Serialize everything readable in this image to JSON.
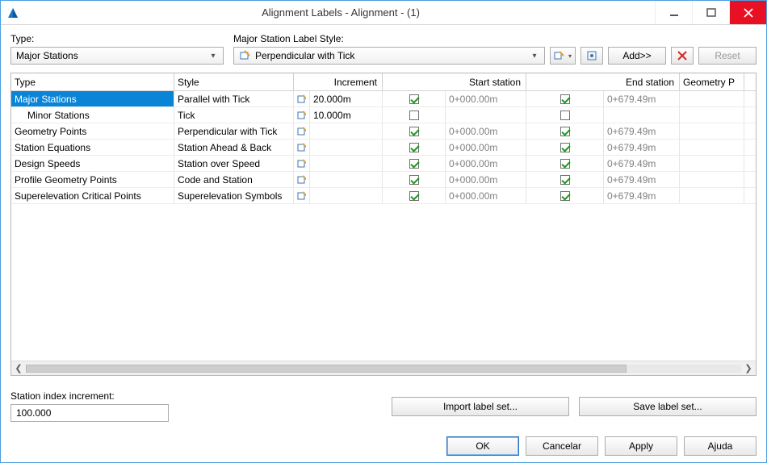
{
  "titlebar": {
    "title": "Alignment Labels - Alignment - (1)"
  },
  "top": {
    "type_label": "Type:",
    "type_value": "Major Stations",
    "style_label": "Major Station Label Style:",
    "style_value": "Perpendicular with Tick",
    "add_label": "Add>>",
    "reset_label": "Reset"
  },
  "columns": {
    "type": "Type",
    "style": "Style",
    "increment": "Increment",
    "start": "Start station",
    "end": "End station",
    "geo": "Geometry P"
  },
  "rows": [
    {
      "type": "Major Stations",
      "indent": 0,
      "sel": true,
      "style": "Parallel with Tick",
      "inc": "20.000m",
      "ss_ck": true,
      "ss": "0+000.00m",
      "es_ck": true,
      "es": "0+679.49m"
    },
    {
      "type": "Minor Stations",
      "indent": 1,
      "sel": false,
      "style": "Tick",
      "inc": "10.000m",
      "ss_ck": false,
      "ss": "",
      "es_ck": false,
      "es": ""
    },
    {
      "type": "Geometry Points",
      "indent": 0,
      "sel": false,
      "style": "Perpendicular with Tick",
      "inc": "",
      "ss_ck": true,
      "ss": "0+000.00m",
      "es_ck": true,
      "es": "0+679.49m"
    },
    {
      "type": "Station Equations",
      "indent": 0,
      "sel": false,
      "style": "Station Ahead & Back",
      "inc": "",
      "ss_ck": true,
      "ss": "0+000.00m",
      "es_ck": true,
      "es": "0+679.49m"
    },
    {
      "type": "Design Speeds",
      "indent": 0,
      "sel": false,
      "style": "Station over Speed",
      "inc": "",
      "ss_ck": true,
      "ss": "0+000.00m",
      "es_ck": true,
      "es": "0+679.49m"
    },
    {
      "type": "Profile Geometry Points",
      "indent": 0,
      "sel": false,
      "style": "Code and Station",
      "inc": "",
      "ss_ck": true,
      "ss": "0+000.00m",
      "es_ck": true,
      "es": "0+679.49m"
    },
    {
      "type": "Superelevation Critical Points",
      "indent": 0,
      "sel": false,
      "style": "Superelevation Symbols",
      "inc": "",
      "ss_ck": true,
      "ss": "0+000.00m",
      "es_ck": true,
      "es": "0+679.49m"
    }
  ],
  "bottom": {
    "station_idx_label": "Station index increment:",
    "station_idx_value": "100.000",
    "import_label": "Import label set...",
    "save_label": "Save label set...",
    "ok": "OK",
    "cancel": "Cancelar",
    "apply": "Apply",
    "help": "Ajuda"
  }
}
